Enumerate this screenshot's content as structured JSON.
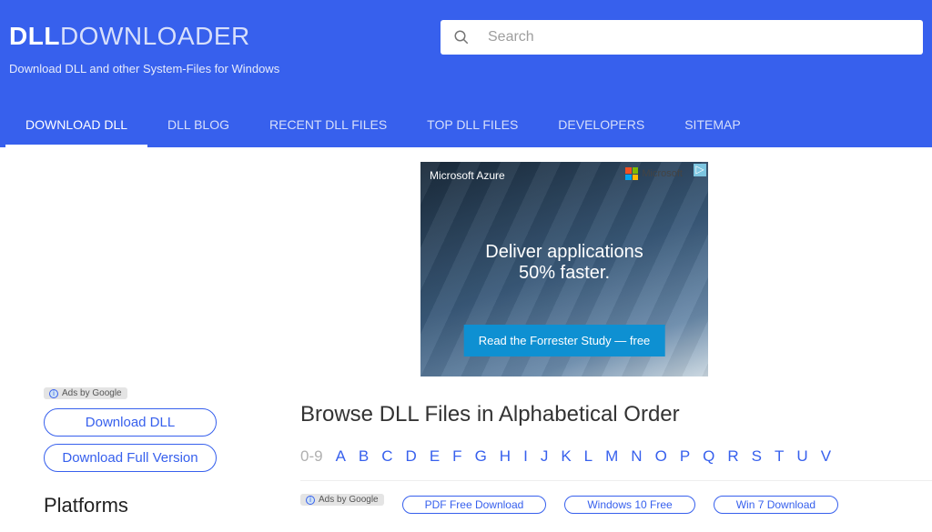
{
  "header": {
    "logo_bold": "DLL",
    "logo_light": "DOWNLOADER",
    "tagline": "Download DLL and other System-Files for Windows",
    "search_placeholder": "Search"
  },
  "nav": [
    "DOWNLOAD DLL",
    "DLL BLOG",
    "RECENT DLL FILES",
    "TOP DLL FILES",
    "DEVELOPERS",
    "SITEMAP"
  ],
  "nav_active_index": 0,
  "sidebar": {
    "ads_label": "Ads by Google",
    "buttons": [
      "Download DLL",
      "Download Full Version"
    ],
    "platforms_heading": "Platforms"
  },
  "ad": {
    "brand_left": "Microsoft Azure",
    "brand_right": "Microsoft",
    "headline_l1": "Deliver applications",
    "headline_l2": "50% faster.",
    "cta": "Read the Forrester Study — free"
  },
  "browse": {
    "heading": "Browse DLL Files in Alphabetical Order",
    "zero": "0-9",
    "letters": [
      "A",
      "B",
      "C",
      "D",
      "E",
      "F",
      "G",
      "H",
      "I",
      "J",
      "K",
      "L",
      "M",
      "N",
      "O",
      "P",
      "Q",
      "R",
      "S",
      "T",
      "U",
      "V"
    ]
  },
  "bottom_ads": {
    "label": "Ads by Google",
    "links": [
      "PDF Free Download",
      "Windows 10 Free",
      "Win 7 Download"
    ]
  }
}
